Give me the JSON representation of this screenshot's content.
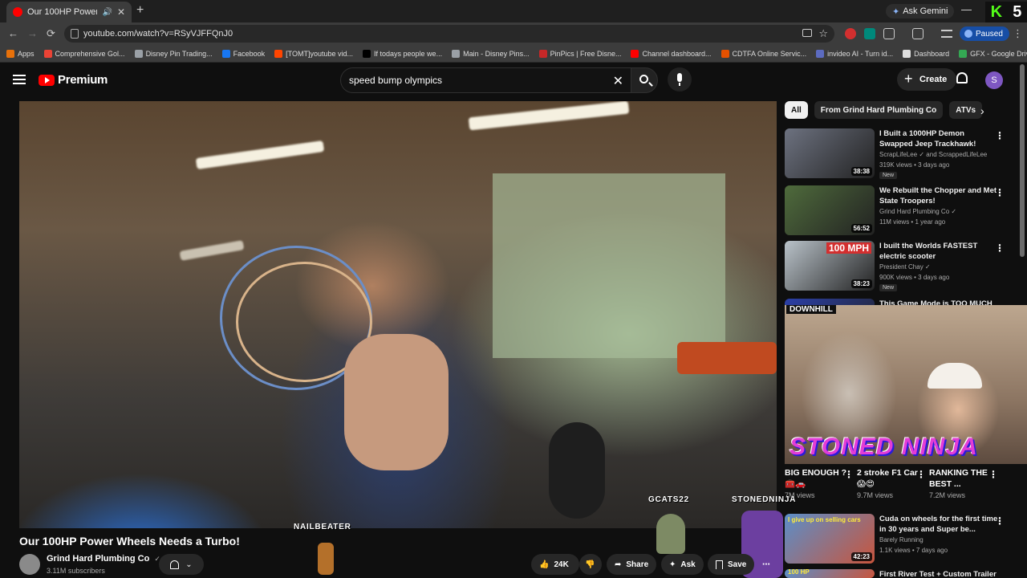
{
  "browser": {
    "tab_title": "Our 100HP Power Wheels Needs a Turbo!",
    "tab_close": "✕",
    "new_tab": "+",
    "ask_gemini": "Ask Gemini",
    "min": "—",
    "kick_k": "K",
    "kick_count": "5",
    "back": "←",
    "forward": "→",
    "reload": "⟳",
    "url": "youtube.com/watch?v=RSyVJFFQnJ0",
    "star": "☆",
    "paused": "Paused",
    "menu": "⋮",
    "bookmarks": [
      {
        "label": "Apps",
        "color": "#e8710a"
      },
      {
        "label": "Comprehensive Gol...",
        "color": "#ea4335"
      },
      {
        "label": "Disney Pin Trading...",
        "color": "#9aa0a6"
      },
      {
        "label": "Facebook",
        "color": "#1877f2"
      },
      {
        "label": "[TOMT]youtube vid...",
        "color": "#ff4500"
      },
      {
        "label": "If todays people we...",
        "color": "#000000"
      },
      {
        "label": "Main - Disney Pins...",
        "color": "#9aa0a6"
      },
      {
        "label": "PinPics | Free Disne...",
        "color": "#c62828"
      },
      {
        "label": "Channel dashboard...",
        "color": "#ff0000"
      },
      {
        "label": "CDTFA Online Servic...",
        "color": "#e65100"
      },
      {
        "label": "invideo AI - Turn id...",
        "color": "#5c6bc0"
      },
      {
        "label": "Dashboard",
        "color": "#dddddd"
      },
      {
        "label": "GFX - Google Drive",
        "color": "#34a853"
      }
    ]
  },
  "youtube": {
    "logo_text": "Premium",
    "search_value": "speed bump olympics",
    "search_clear": "✕",
    "create_label": "Create",
    "avatar_letter": "S",
    "video": {
      "title": "Our 100HP Power Wheels Needs a Turbo!",
      "channel": "Grind Hard Plumbing Co",
      "verified": "✓",
      "subscribers": "3.11M subscribers",
      "likes": "24K",
      "share": "Share",
      "ask": "Ask",
      "save": "Save",
      "more": "⋯"
    },
    "overlays": {
      "nailbeater": "NAILBEATER",
      "gcats": "GCATS22",
      "stonedninja": "STONEDNINJA"
    },
    "chips": [
      "All",
      "From Grind Hard Plumbing Co",
      "ATVs"
    ],
    "chip_next": "›",
    "recommendations": [
      {
        "title": "I Built a 1000HP Demon Swapped Jeep Trackhawk!",
        "channel": "ScrapLifeLee ✓ and ScrappedLifeLee",
        "meta": "319K views • 3 days ago",
        "duration": "38:38",
        "badge": "New",
        "thumb_color": "#6d7280"
      },
      {
        "title": "We Rebuilt the Chopper and Met State Troopers!",
        "channel": "Grind Hard Plumbing Co ✓",
        "meta": "11M views • 1 year ago",
        "duration": "56:52",
        "badge": "",
        "thumb_color": "#4f6b3c"
      },
      {
        "title": "I built the Worlds FASTEST electric scooter",
        "channel": "President Chay ✓",
        "meta": "900K views • 3 days ago",
        "duration": "38:23",
        "badge": "New",
        "thumb_color": "#b9c2c9",
        "thumb_text": "100 MPH"
      },
      {
        "title": "This Game Mode is TOO MUCH",
        "channel": "",
        "meta": "",
        "duration": "",
        "badge": "",
        "thumb_color": "#2b3fa8"
      }
    ],
    "cam_overlay_text": "STONED NINJA",
    "cam_top_label": "DOWNHILL",
    "shorts": [
      {
        "title": "BIG ENOUGH ? 🧰🚗",
        "views": "7M views"
      },
      {
        "title": "2 stroke F1 Car 😱😍",
        "views": "9.7M views"
      },
      {
        "title": "RANKING THE BEST ...",
        "views": "7.2M views"
      }
    ],
    "more_recs": [
      {
        "title": "Cuda on wheels for the first time in 30 years and Super be...",
        "channel": "Barely Running",
        "meta": "1.1K views • 7 days ago",
        "duration": "42:23",
        "thumb_text": "I give up on selling cars"
      },
      {
        "title": "First River Test + Custom Trailer",
        "thumb_text": "100 HP"
      }
    ]
  }
}
